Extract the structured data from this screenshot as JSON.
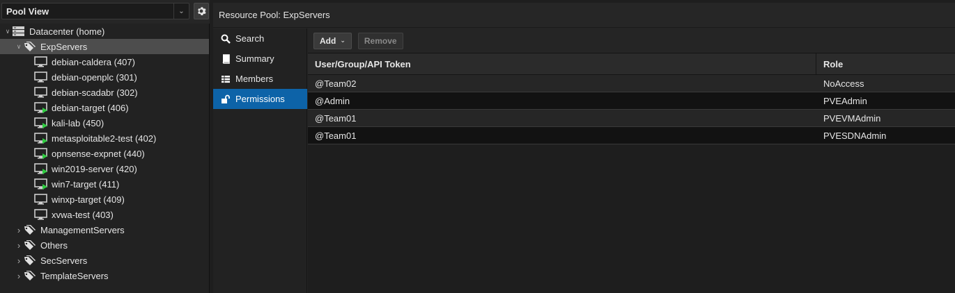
{
  "tree_panel": {
    "view_label": "Pool View",
    "nodes": [
      {
        "label": "Datacenter (home)",
        "level": 0,
        "icon": "datacenter-icon",
        "arrow": "expanded"
      },
      {
        "label": "ExpServers",
        "level": 1,
        "icon": "pool-tag-icon",
        "arrow": "expanded",
        "selected": true
      },
      {
        "label": "debian-caldera (407)",
        "level": 2,
        "icon": "vm-stopped-icon"
      },
      {
        "label": "debian-openplc (301)",
        "level": 2,
        "icon": "vm-stopped-icon"
      },
      {
        "label": "debian-scadabr (302)",
        "level": 2,
        "icon": "vm-stopped-icon"
      },
      {
        "label": "debian-target (406)",
        "level": 2,
        "icon": "vm-running-icon"
      },
      {
        "label": "kali-lab (450)",
        "level": 2,
        "icon": "vm-running-icon"
      },
      {
        "label": "metasploitable2-test (402)",
        "level": 2,
        "icon": "vm-running-icon"
      },
      {
        "label": "opnsense-expnet (440)",
        "level": 2,
        "icon": "vm-running-icon"
      },
      {
        "label": "win2019-server (420)",
        "level": 2,
        "icon": "vm-running-icon"
      },
      {
        "label": "win7-target (411)",
        "level": 2,
        "icon": "vm-running-icon"
      },
      {
        "label": "winxp-target (409)",
        "level": 2,
        "icon": "vm-stopped-icon"
      },
      {
        "label": "xvwa-test (403)",
        "level": 2,
        "icon": "vm-stopped-icon"
      },
      {
        "label": "ManagementServers",
        "level": 1,
        "icon": "pool-tag-icon",
        "arrow": "collapsed"
      },
      {
        "label": "Others",
        "level": 1,
        "icon": "pool-tag-icon",
        "arrow": "collapsed"
      },
      {
        "label": "SecServers",
        "level": 1,
        "icon": "pool-tag-icon",
        "arrow": "collapsed"
      },
      {
        "label": "TemplateServers",
        "level": 1,
        "icon": "pool-tag-icon",
        "arrow": "collapsed"
      }
    ]
  },
  "main": {
    "title": "Resource Pool: ExpServers",
    "nav": [
      {
        "label": "Search",
        "icon": "search-icon"
      },
      {
        "label": "Summary",
        "icon": "book-icon"
      },
      {
        "label": "Members",
        "icon": "grid-icon"
      },
      {
        "label": "Permissions",
        "icon": "unlock-icon",
        "active": true
      }
    ],
    "toolbar": {
      "add_label": "Add",
      "remove_label": "Remove"
    },
    "grid": {
      "columns": [
        "User/Group/API Token",
        "Role"
      ],
      "rows": [
        {
          "user": "@Team02",
          "role": "NoAccess"
        },
        {
          "user": "@Admin",
          "role": "PVEAdmin"
        },
        {
          "user": "@Team01",
          "role": "PVEVMAdmin"
        },
        {
          "user": "@Team01",
          "role": "PVESDNAdmin"
        }
      ]
    }
  },
  "colors": {
    "accent": "#0d63a8",
    "selected_row": "#4d4d4d",
    "running": "#2ecc40"
  }
}
